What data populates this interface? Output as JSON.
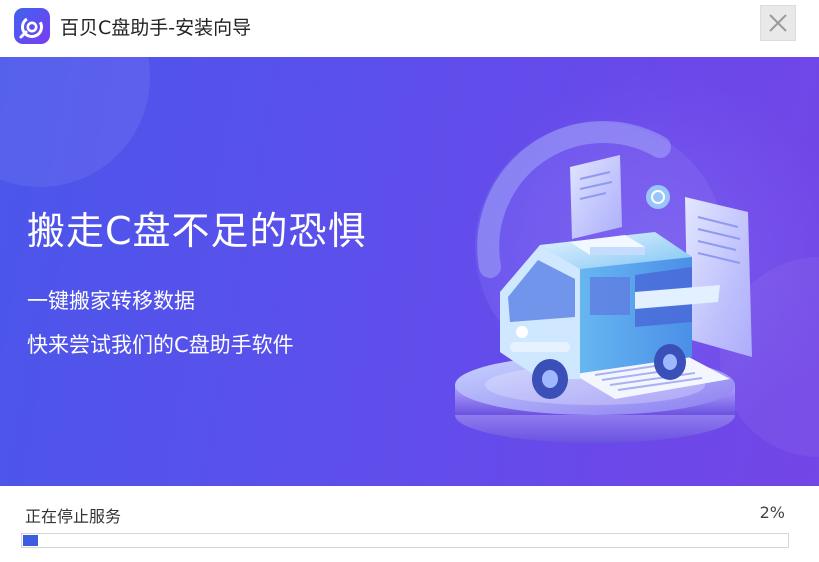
{
  "window": {
    "title": "百贝C盘助手-安装向导",
    "close_icon": "close-icon",
    "app_icon": "app-logo-icon"
  },
  "banner": {
    "headline": "搬走C盘不足的恐惧",
    "line1": "一键搬家转移数据",
    "line2": "快来尝试我们的C盘助手软件",
    "illustration": "van-data-migration-illustration"
  },
  "progress": {
    "status": "正在停止服务",
    "percent_label": "2%",
    "fraction": 0.02,
    "accent": "#3e5ce0"
  }
}
